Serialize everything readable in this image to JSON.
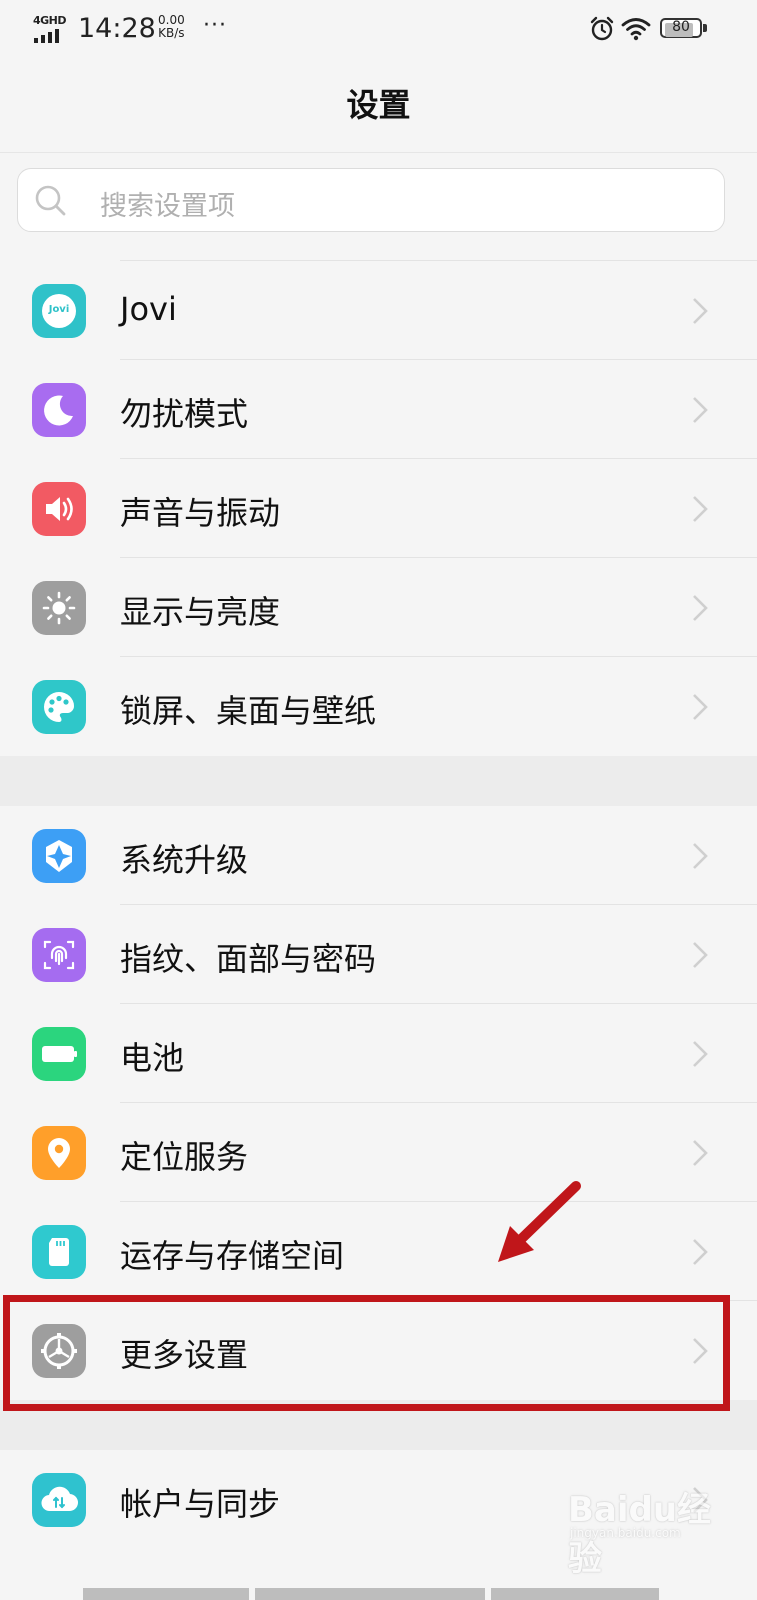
{
  "status_bar": {
    "network": "4GHD",
    "time": "14:28",
    "speed_value": "0.00",
    "speed_unit": "KB/s",
    "more": "···",
    "battery": "80"
  },
  "page": {
    "title": "设置"
  },
  "search": {
    "placeholder": "搜索设置项",
    "icon": "search-icon"
  },
  "groups": [
    {
      "items": [
        {
          "label": "Jovi",
          "icon": "jovi-icon",
          "color": "#2fc2c9",
          "icon_text": "Jovi"
        },
        {
          "label": "勿扰模式",
          "icon": "moon-icon",
          "color": "#a86cf0"
        },
        {
          "label": "声音与振动",
          "icon": "speaker-icon",
          "color": "#f25a63"
        },
        {
          "label": "显示与亮度",
          "icon": "brightness-icon",
          "color": "#9e9e9e"
        },
        {
          "label": "锁屏、桌面与壁纸",
          "icon": "palette-icon",
          "color": "#2fc7c9"
        }
      ]
    },
    {
      "items": [
        {
          "label": "系统升级",
          "icon": "upgrade-icon",
          "color": "#3d9ff5"
        },
        {
          "label": "指纹、面部与密码",
          "icon": "fingerprint-icon",
          "color": "#a56cf0"
        },
        {
          "label": "电池",
          "icon": "battery-icon",
          "color": "#2bd57e"
        },
        {
          "label": "定位服务",
          "icon": "location-icon",
          "color": "#ff9f2a"
        },
        {
          "label": "运存与存储空间",
          "icon": "sdcard-icon",
          "color": "#2fc9cf"
        },
        {
          "label": "更多设置",
          "icon": "gear-icon",
          "color": "#9e9e9e",
          "highlighted": true
        }
      ]
    },
    {
      "items": [
        {
          "label": "帐户与同步",
          "icon": "cloud-sync-icon",
          "color": "#2fc2cf"
        }
      ]
    }
  ],
  "watermark": {
    "logo": "Baidu经验",
    "url": "jingyan.baidu.com"
  },
  "colors": {
    "annotation": "#c0161a",
    "background": "#f5f5f5",
    "section_gap": "#ececec"
  }
}
